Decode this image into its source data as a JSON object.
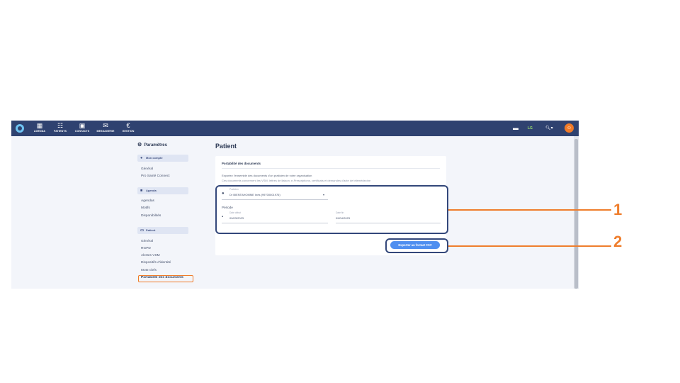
{
  "topbar": {
    "nav": [
      {
        "label": "AGENDA",
        "icon": "calendar-icon"
      },
      {
        "label": "PATIENTS",
        "icon": "patients-icon"
      },
      {
        "label": "CONTACTS",
        "icon": "contacts-icon"
      },
      {
        "label": "MESSAGERIE",
        "icon": "mail-icon"
      },
      {
        "label": "GESTION",
        "icon": "euro-icon"
      }
    ],
    "right_badge": "LG"
  },
  "sidebar": {
    "title": "Paramètres",
    "sections": [
      {
        "label": "Mon compte",
        "items": [
          "Général",
          "Pro Santé Connect"
        ]
      },
      {
        "label": "Agenda",
        "items": [
          "Agendas",
          "Motifs",
          "Disponibilités"
        ]
      },
      {
        "label": "Patient",
        "items": [
          "Général",
          "RGPD",
          "Alertes VSM",
          "Dispositifs d'identité",
          "Mots-clefs",
          "Portabilité des documents"
        ]
      }
    ]
  },
  "main": {
    "title": "Patient",
    "card": {
      "title": "Portabilité des documents",
      "desc1": "Exportez l'ensemble des documents d'un praticien de votre organisation",
      "desc2": "Ces documents concernent les VSM, lettres de liaison, e-Prescriptions, certificats et demandes d'acte de télémédecine",
      "praticien_label": "Praticien",
      "praticien_value": "Dr BIENTAHOMME Inès (99700001976)",
      "periode_label": "Période",
      "start_label": "Date début",
      "start_value": "09/03/2023",
      "end_label": "Date fin",
      "end_value": "09/04/2023",
      "export_button": "Exporter au format CSV"
    }
  },
  "callouts": [
    "1",
    "2"
  ],
  "colors": {
    "topbar": "#2f4270",
    "accent": "#4f8ff0",
    "highlight": "#ef7e2d"
  }
}
